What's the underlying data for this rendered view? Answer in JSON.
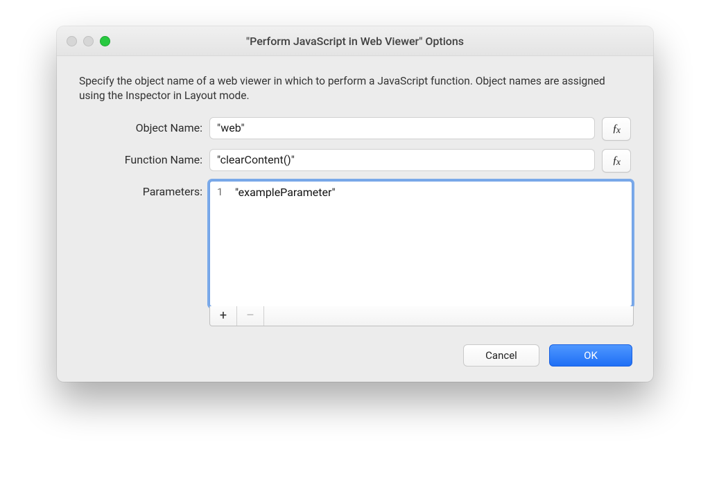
{
  "window": {
    "title": "\"Perform JavaScript in Web Viewer\" Options"
  },
  "description": "Specify the object name of a web viewer in which to perform a JavaScript function. Object names are assigned using the Inspector in Layout mode.",
  "form": {
    "object_name": {
      "label": "Object Name:",
      "value": "\"web\""
    },
    "function_name": {
      "label": "Function Name:",
      "value": "\"clearContent()\""
    },
    "parameters": {
      "label": "Parameters:",
      "rows": [
        {
          "line": "1",
          "value": "\"exampleParameter\""
        }
      ],
      "add_label": "+",
      "remove_label": "–"
    }
  },
  "fx_label": "ƒx",
  "buttons": {
    "cancel": "Cancel",
    "ok": "OK"
  }
}
